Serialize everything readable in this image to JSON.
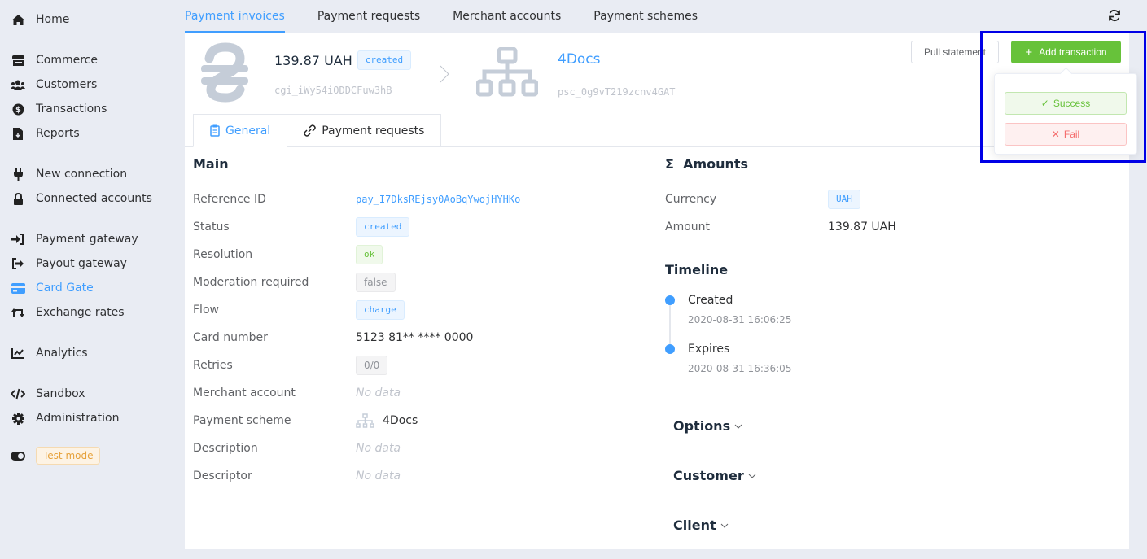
{
  "sidebar": {
    "items": [
      {
        "label": "Home",
        "icon": "home-icon"
      },
      {
        "label": "Commerce",
        "icon": "store-icon"
      },
      {
        "label": "Customers",
        "icon": "users-icon"
      },
      {
        "label": "Transactions",
        "icon": "dollar-circle-icon"
      },
      {
        "label": "Reports",
        "icon": "file-download-icon"
      },
      {
        "label": "New connection",
        "icon": "plug-icon"
      },
      {
        "label": "Connected accounts",
        "icon": "lock-icon"
      },
      {
        "label": "Payment gateway",
        "icon": "sign-in-icon"
      },
      {
        "label": "Payout gateway",
        "icon": "sign-out-icon"
      },
      {
        "label": "Card Gate",
        "icon": "credit-card-icon",
        "active": true
      },
      {
        "label": "Exchange rates",
        "icon": "exchange-icon"
      },
      {
        "label": "Analytics",
        "icon": "chart-line-icon"
      },
      {
        "label": "Sandbox",
        "icon": "code-icon"
      },
      {
        "label": "Administration",
        "icon": "gear-icon"
      }
    ],
    "test_mode": {
      "label": "Test mode",
      "icon": "toggle-icon"
    }
  },
  "top_tabs": [
    {
      "label": "Payment invoices",
      "active": true
    },
    {
      "label": "Payment requests"
    },
    {
      "label": "Merchant accounts"
    },
    {
      "label": "Payment schemes"
    }
  ],
  "header": {
    "amount": "139.87 UAH",
    "status_tag": "created",
    "invoice_id": "cgi_iWy54iODDCFuw3hB",
    "scheme_name": "4Docs",
    "scheme_id": "psc_0g9vT219zcnv4GAT",
    "pull_statement_label": "Pull statement",
    "add_transaction_label": "Add transaction"
  },
  "add_transaction_menu": {
    "success_label": "Success",
    "fail_label": "Fail"
  },
  "sub_tabs": [
    {
      "label": "General",
      "icon": "clipboard-icon",
      "active": true
    },
    {
      "label": "Payment requests",
      "icon": "link-icon"
    }
  ],
  "main": {
    "title": "Main",
    "rows": [
      {
        "label": "Reference ID",
        "value": "pay_I7DksREjsy0AoBqYwojHYHKo"
      },
      {
        "label": "Status",
        "value": "created"
      },
      {
        "label": "Resolution",
        "value": "ok"
      },
      {
        "label": "Moderation required",
        "value": "false"
      },
      {
        "label": "Flow",
        "value": "charge"
      },
      {
        "label": "Card number",
        "value": "5123 81** **** 0000"
      },
      {
        "label": "Retries",
        "value": "0/0"
      },
      {
        "label": "Merchant account",
        "value": "No data"
      },
      {
        "label": "Payment scheme",
        "value": "4Docs"
      },
      {
        "label": "Description",
        "value": "No data"
      },
      {
        "label": "Descriptor",
        "value": "No data"
      }
    ]
  },
  "amounts": {
    "title": "Amounts",
    "currency_label": "Currency",
    "currency": "UAH",
    "amount_label": "Amount",
    "amount": "139.87 UAH"
  },
  "timeline": {
    "title": "Timeline",
    "events": [
      {
        "title": "Created",
        "time": "2020-08-31 16:06:25"
      },
      {
        "title": "Expires",
        "time": "2020-08-31 16:36:05"
      }
    ]
  },
  "collapsibles": [
    "Options",
    "Customer",
    "Client"
  ],
  "colors": {
    "accent": "#409eff",
    "success": "#67c23a",
    "danger": "#f56c6c",
    "warning": "#e6a23c"
  }
}
